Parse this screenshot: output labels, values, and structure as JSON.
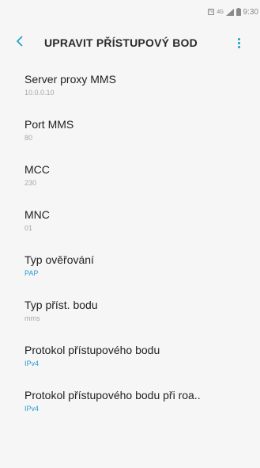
{
  "status_bar": {
    "nfc": "N",
    "network": "4G",
    "time": "9:30"
  },
  "header": {
    "title": "UPRAVIT PŘÍSTUPOVÝ BOD",
    "back_icon": "chevron-left-icon",
    "more_icon": "more-vertical-icon"
  },
  "colors": {
    "accent": "#1aa0c4",
    "value_accent": "#2d9ed4",
    "value_muted": "#a6a6a6",
    "background": "#f6f6f6"
  },
  "settings": [
    {
      "label": "Server proxy MMS",
      "value": "10.0.0.10"
    },
    {
      "label": "Port MMS",
      "value": "80"
    },
    {
      "label": "MCC",
      "value": "230"
    },
    {
      "label": "MNC",
      "value": "01"
    },
    {
      "label": "Typ ověřování",
      "value": "PAP"
    },
    {
      "label": "Typ příst. bodu",
      "value": "mms"
    },
    {
      "label": "Protokol přístupového bodu",
      "value": "IPv4"
    },
    {
      "label": "Protokol přístupového bodu při roa..",
      "value": "IPv4"
    }
  ]
}
